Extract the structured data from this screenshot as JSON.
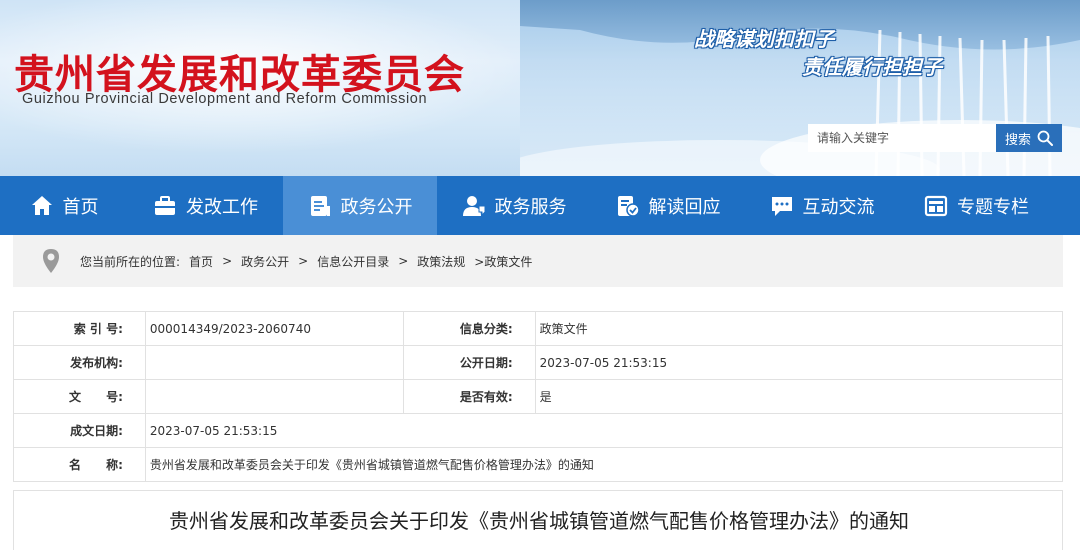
{
  "header": {
    "title": "贵州省发展和改革委员会",
    "subtitle": "Guizhou Provincial Development and Reform Commission",
    "slogan_line1": "战略谋划扣扣子",
    "slogan_line2": "责任履行担担子"
  },
  "search": {
    "placeholder": "请输入关键字",
    "button_label": "搜索",
    "icon": "search-icon"
  },
  "nav": {
    "items": [
      {
        "label": "首页",
        "icon": "home-icon"
      },
      {
        "label": "发改工作",
        "icon": "briefcase-icon"
      },
      {
        "label": "政务公开",
        "icon": "document-icon",
        "active": true
      },
      {
        "label": "政务服务",
        "icon": "user-service-icon"
      },
      {
        "label": "解读回应",
        "icon": "reply-icon"
      },
      {
        "label": "互动交流",
        "icon": "chat-icon"
      },
      {
        "label": "专题专栏",
        "icon": "column-icon"
      }
    ]
  },
  "breadcrumb": {
    "prefix": "您当前所在的位置:",
    "items": [
      "首页",
      "政务公开",
      "信息公开目录",
      "政策法规",
      ">政策文件"
    ],
    "separator": ">"
  },
  "info": {
    "index_label": "索 引 号:",
    "index_value": "000014349/2023-2060740",
    "category_label": "信息分类:",
    "category_value": "政策文件",
    "publisher_label": "发布机构:",
    "publisher_value": "",
    "publish_date_label": "公开日期:",
    "publish_date_value": "2023-07-05 21:53:15",
    "doc_no_label": "文      号:",
    "doc_no_value": "",
    "valid_label": "是否有效:",
    "valid_value": "是",
    "written_date_label": "成文日期:",
    "written_date_value": "2023-07-05 21:53:15",
    "name_label": "名      称:",
    "name_value": "贵州省发展和改革委员会关于印发《贵州省城镇管道燃气配售价格管理办法》的通知"
  },
  "document": {
    "title": "贵州省发展和改革委员会关于印发《贵州省城镇管道燃气配售价格管理办法》的通知"
  },
  "colors": {
    "brand_red": "#d3121d",
    "nav_blue": "#1e6fc3",
    "nav_active": "#4a8fd6",
    "search_button": "#2a6fba"
  }
}
